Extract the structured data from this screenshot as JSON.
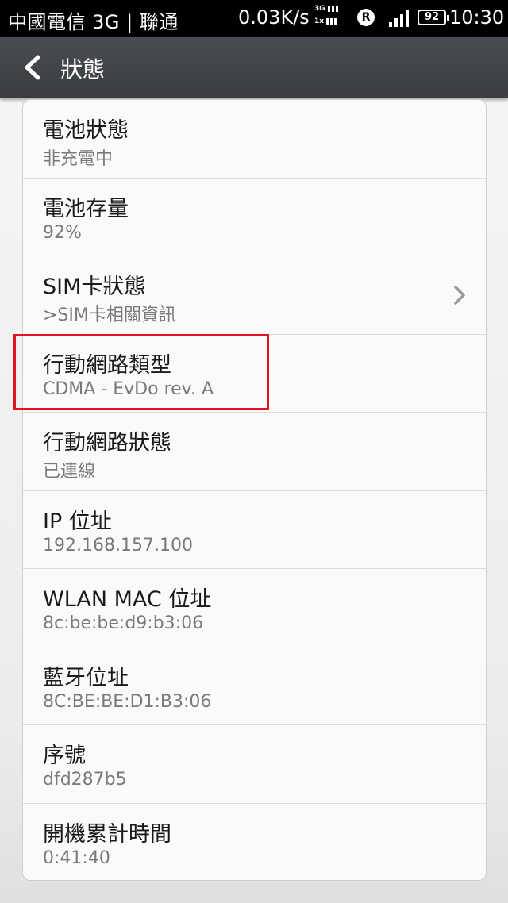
{
  "status_bar": {
    "carrier": "中國電信 3G | 聯通",
    "speed": "0.03K/s",
    "net_top": "3G",
    "net_bottom": "1x",
    "roaming": "R",
    "battery": "92",
    "time": "10:30"
  },
  "header": {
    "title": "狀態"
  },
  "items": [
    {
      "title": "電池狀態",
      "value": "非充電中"
    },
    {
      "title": "電池存量",
      "value": "92%"
    },
    {
      "title": "SIM卡狀態",
      "value": ">SIM卡相關資訊"
    },
    {
      "title": "行動網路類型",
      "value": "CDMA - EvDo rev. A"
    },
    {
      "title": "行動網路狀態",
      "value": "已連線"
    },
    {
      "title": "IP 位址",
      "value": "192.168.157.100"
    },
    {
      "title": "WLAN MAC 位址",
      "value": "8c:be:be:d9:b3:06"
    },
    {
      "title": "藍牙位址",
      "value": "8C:BE:BE:D1:B3:06"
    },
    {
      "title": "序號",
      "value": "dfd287b5"
    },
    {
      "title": "開機累計時間",
      "value": "0:41:40"
    }
  ],
  "colors": {
    "highlight": "#e0141e"
  }
}
